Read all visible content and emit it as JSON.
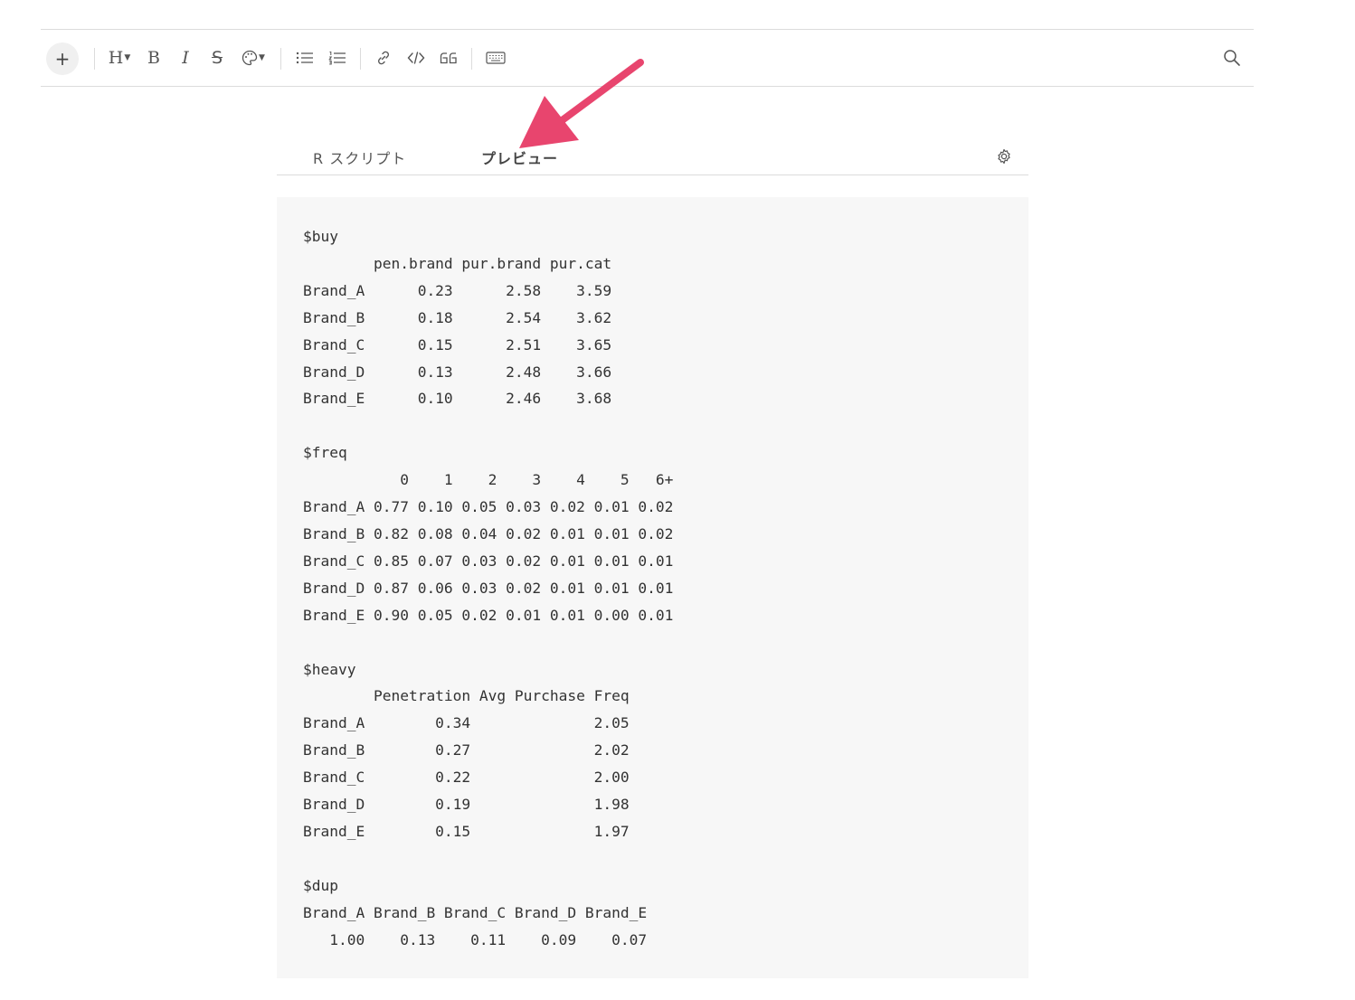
{
  "toolbar": {
    "plus_label": "+",
    "heading_label": "H",
    "bold_label": "B",
    "italic_label": "I",
    "strike_label": "S",
    "icons": [
      "plus-icon",
      "heading-icon",
      "bold-icon",
      "italic-icon",
      "strikethrough-icon",
      "palette-icon",
      "bullet-list-icon",
      "numbered-list-icon",
      "link-icon",
      "code-icon",
      "quote-icon",
      "keyboard-icon",
      "search-icon"
    ]
  },
  "tabs": [
    {
      "label": "R スクリプト",
      "active": false
    },
    {
      "label": "プレビュー",
      "active": true
    }
  ],
  "annotation": {
    "type": "arrow",
    "color": "#e8456e",
    "points_to": "プレビュー"
  },
  "output": {
    "text": "$buy\n        pen.brand pur.brand pur.cat\nBrand_A      0.23      2.58    3.59\nBrand_B      0.18      2.54    3.62\nBrand_C      0.15      2.51    3.65\nBrand_D      0.13      2.48    3.66\nBrand_E      0.10      2.46    3.68\n\n$freq\n           0    1    2    3    4    5   6+\nBrand_A 0.77 0.10 0.05 0.03 0.02 0.01 0.02\nBrand_B 0.82 0.08 0.04 0.02 0.01 0.01 0.02\nBrand_C 0.85 0.07 0.03 0.02 0.01 0.01 0.01\nBrand_D 0.87 0.06 0.03 0.02 0.01 0.01 0.01\nBrand_E 0.90 0.05 0.02 0.01 0.01 0.00 0.01\n\n$heavy\n        Penetration Avg Purchase Freq\nBrand_A        0.34              2.05\nBrand_B        0.27              2.02\nBrand_C        0.22              2.00\nBrand_D        0.19              1.98\nBrand_E        0.15              1.97\n\n$dup\nBrand_A Brand_B Brand_C Brand_D Brand_E\n   1.00    0.13    0.11    0.09    0.07"
  }
}
